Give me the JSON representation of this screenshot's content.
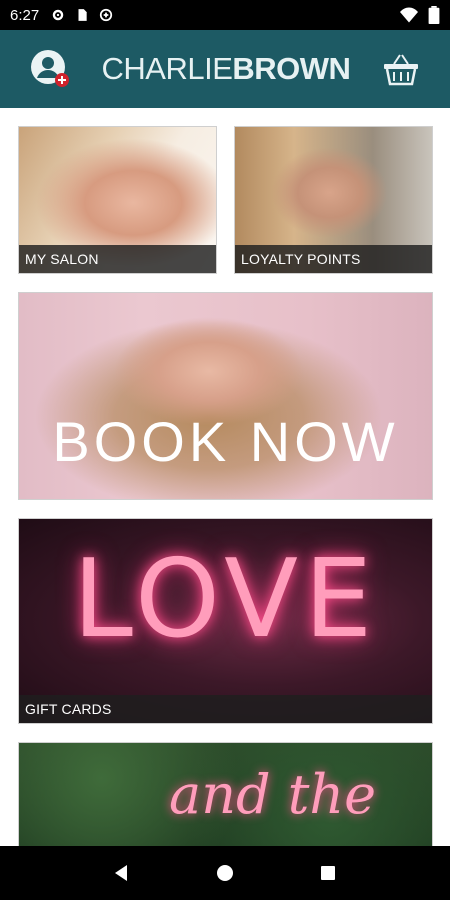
{
  "status_bar": {
    "time": "6:27",
    "icons_left": [
      "gear-icon",
      "sim-card-icon",
      "data-saver-icon"
    ],
    "icons_right": [
      "wifi-icon",
      "battery-icon"
    ]
  },
  "app_bar": {
    "logo_part1": "CHARLIE",
    "logo_part2": "BROWN",
    "account_icon": "account-icon",
    "basket_icon": "basket-icon",
    "color": "#1d5a64"
  },
  "tiles": {
    "my_salon": "MY SALON",
    "loyalty_points": "LOYALTY POINTS",
    "book_now": "BOOK NOW",
    "gift_cards": "GIFT CARDS"
  },
  "nav_bar": {
    "back_icon": "back-icon",
    "home_icon": "home-icon",
    "recents_icon": "recents-icon"
  }
}
